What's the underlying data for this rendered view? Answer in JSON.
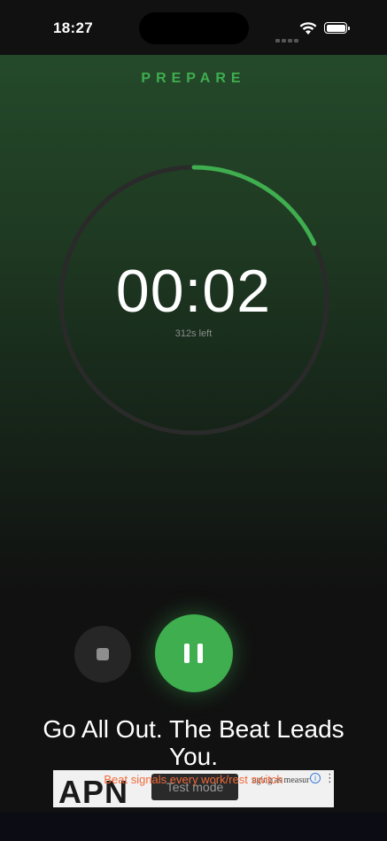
{
  "status_bar": {
    "time": "18:27"
  },
  "timer": {
    "phase": "PREPARE",
    "countdown": "00:02",
    "remaining": "312s left",
    "progress": 0.18,
    "accent_color": "#3fae4f",
    "track_color": "#2a2a2a"
  },
  "controls": {
    "stop_icon": "stop-icon",
    "pause_icon": "pause-icon"
  },
  "motto": {
    "line1": "Go All Out. The Beat Leads",
    "line2": "You."
  },
  "ad": {
    "logo_text": "APN",
    "badge": "Test mode",
    "snippet": "aging as measur",
    "info_icon": "info-icon",
    "menu_icon": "more-vertical-icon"
  },
  "hint": "Beat signals every work/rest switch"
}
